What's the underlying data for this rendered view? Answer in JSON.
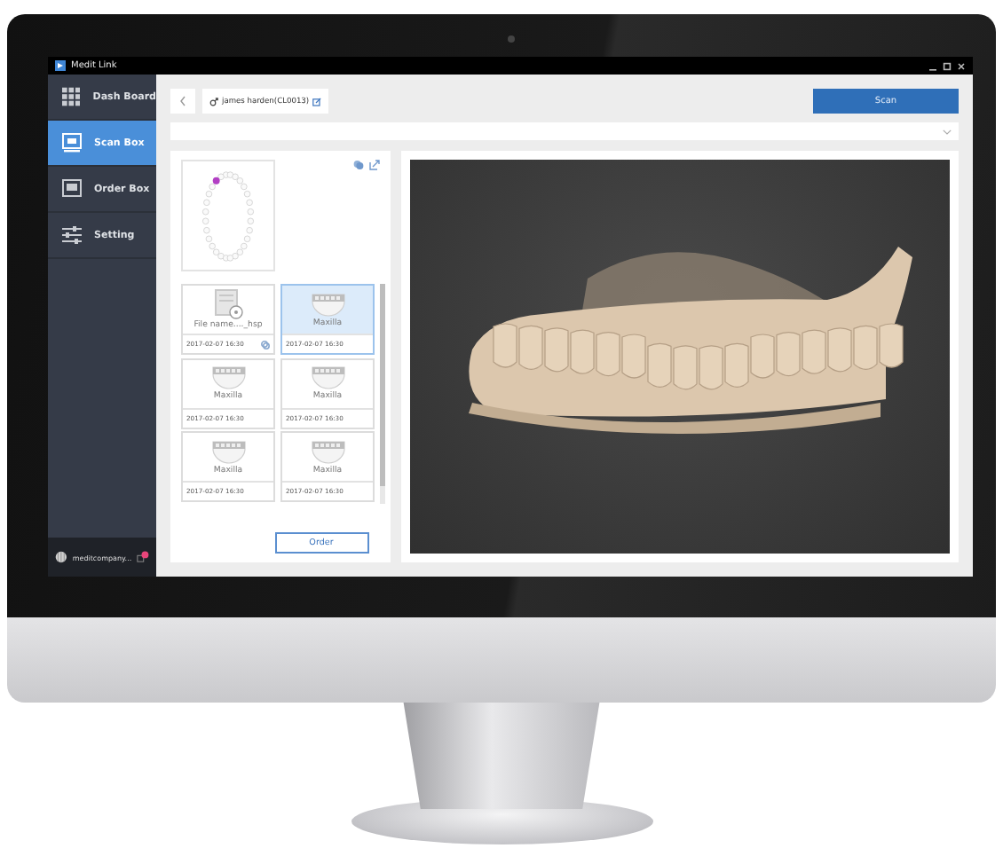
{
  "window": {
    "title": "Medit Link"
  },
  "sidebar": {
    "items": [
      {
        "label": "Dash Board",
        "selected": false
      },
      {
        "label": "Scan Box",
        "selected": true
      },
      {
        "label": "Order Box",
        "selected": false
      },
      {
        "label": "Setting",
        "selected": false
      }
    ],
    "account": {
      "name": "meditcompany..."
    }
  },
  "toolbar": {
    "patient": "james harden(CL0013)",
    "scan_button": "Scan"
  },
  "files": [
    {
      "kind": "unknown",
      "caption": "File name...._hsp",
      "date": "2017-02-07 16:30",
      "selected": false
    },
    {
      "kind": "scan",
      "caption": "Maxilla",
      "date": "2017-02-07 16:30",
      "selected": true
    },
    {
      "kind": "scan",
      "caption": "Maxilla",
      "date": "2017-02-07 16:30",
      "selected": false
    },
    {
      "kind": "scan",
      "caption": "Maxilla",
      "date": "2017-02-07 16:30",
      "selected": false
    },
    {
      "kind": "scan",
      "caption": "Maxilla",
      "date": "2017-02-07 16:30",
      "selected": false
    },
    {
      "kind": "scan",
      "caption": "Maxilla",
      "date": "2017-02-07 16:30",
      "selected": false
    }
  ],
  "order_button": "Order"
}
